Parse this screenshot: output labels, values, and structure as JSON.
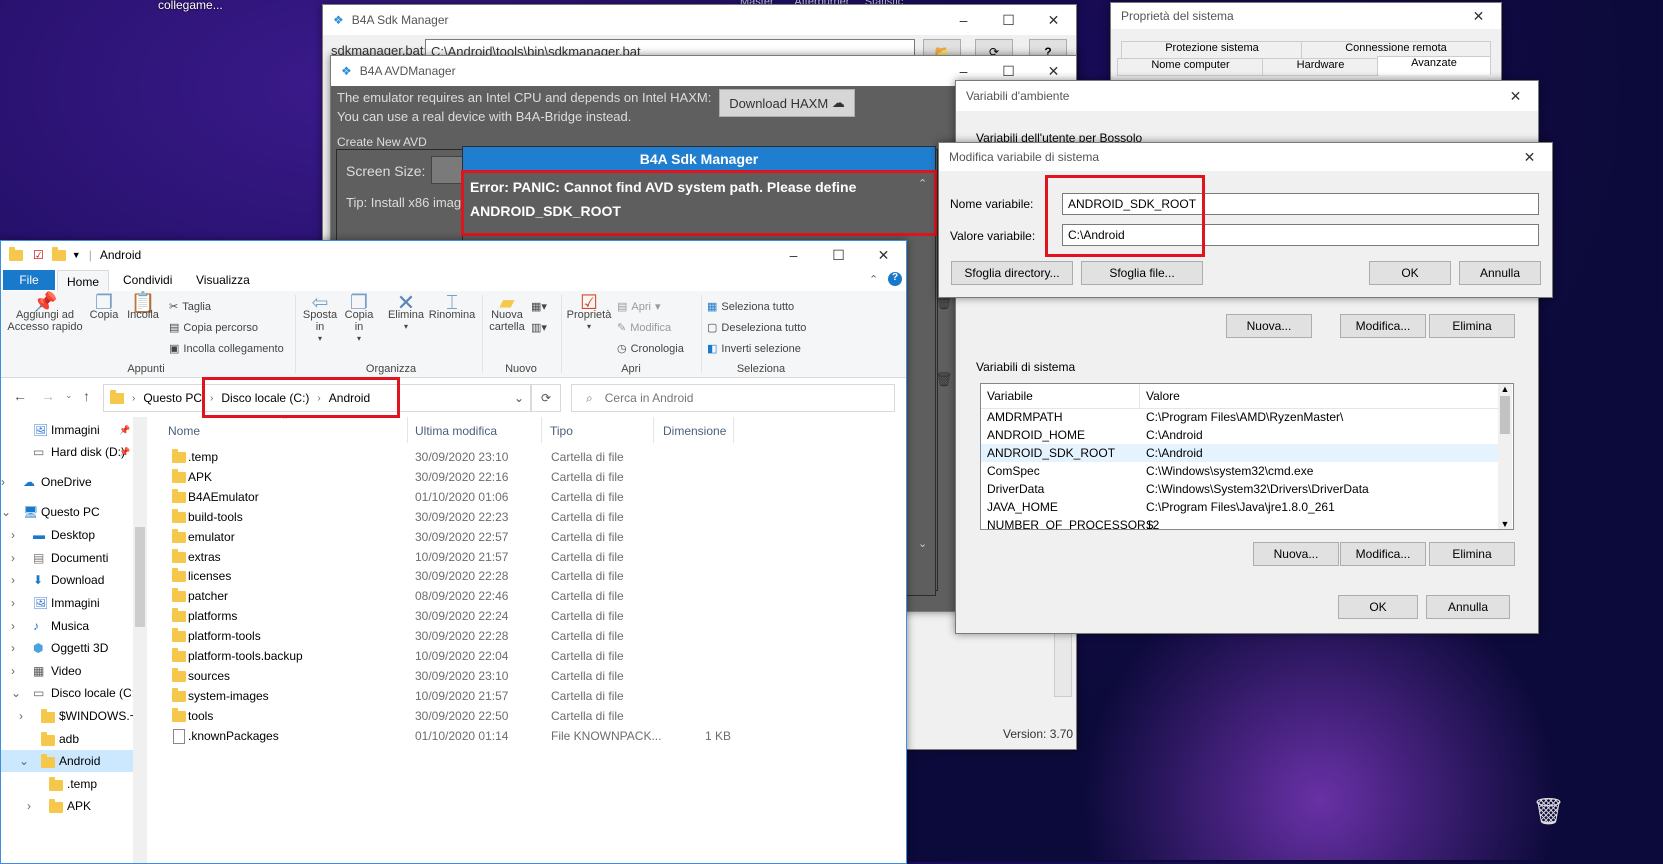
{
  "desktop": {
    "top_label": "collegame..."
  },
  "sdk_manager": {
    "title": "B4A Sdk Manager",
    "sdkmanager_label": "sdkmanager.bat:",
    "sdkmanager_path": "C:\\Android\\tools\\bin\\sdkmanager.bat",
    "version": "Version: 3.70"
  },
  "avd_manager": {
    "title": "B4A AVDManager",
    "haxm_line1": "The emulator requires an Intel CPU and depends on Intel HAXM:",
    "haxm_line2": "You can use a real device with B4A-Bridge instead.",
    "download_haxm": "Download HAXM",
    "create_avd": "Create New AVD",
    "screen_size": "Screen Size:",
    "tip": "Tip: Install x86 imag"
  },
  "error_dialog": {
    "title": "B4A Sdk Manager",
    "message_line1": "Error: PANIC: Cannot find AVD system path. Please define",
    "message_line2": "ANDROID_SDK_ROOT"
  },
  "system_properties": {
    "title": "Proprietà del sistema",
    "tabs_row1": [
      "Protezione sistema",
      "Connessione remota"
    ],
    "tabs_row2": [
      "Nome computer",
      "Hardware",
      "Avanzate"
    ]
  },
  "env_vars": {
    "title": "Variabili d'ambiente",
    "user_section": "Variabili dell'utente per Bossolo",
    "user_buttons": [
      "Nuova...",
      "Modifica...",
      "Elimina"
    ],
    "system_section": "Variabili di sistema",
    "columns": [
      "Variabile",
      "Valore"
    ],
    "rows": [
      [
        "AMDRMPATH",
        "C:\\Program Files\\AMD\\RyzenMaster\\"
      ],
      [
        "ANDROID_HOME",
        "C:\\Android"
      ],
      [
        "ANDROID_SDK_ROOT",
        "C:\\Android"
      ],
      [
        "ComSpec",
        "C:\\Windows\\system32\\cmd.exe"
      ],
      [
        "DriverData",
        "C:\\Windows\\System32\\Drivers\\DriverData"
      ],
      [
        "JAVA_HOME",
        "C:\\Program Files\\Java\\jre1.8.0_261"
      ],
      [
        "NUMBER_OF_PROCESSORS",
        "12"
      ]
    ],
    "system_buttons": [
      "Nuova...",
      "Modifica...",
      "Elimina"
    ],
    "ok": "OK",
    "cancel": "Annulla"
  },
  "edit_var": {
    "title": "Modifica variabile di sistema",
    "name_label": "Nome variabile:",
    "name_value": "ANDROID_SDK_ROOT",
    "value_label": "Valore variabile:",
    "value_value": "C:\\Android",
    "browse_dir": "Sfoglia directory...",
    "browse_file": "Sfoglia file...",
    "ok": "OK",
    "cancel": "Annulla"
  },
  "explorer": {
    "title": "Android",
    "ribbon_tabs": [
      "File",
      "Home",
      "Condividi",
      "Visualizza"
    ],
    "appunti": {
      "label": "Appunti",
      "pin": "Aggiungi ad Accesso rapido",
      "copy": "Copia",
      "paste": "Incolla",
      "cut": "Taglia",
      "copy_path": "Copia percorso",
      "paste_link": "Incolla collegamento"
    },
    "organizza": {
      "label": "Organizza",
      "move": "Sposta in",
      "copy_to": "Copia in",
      "delete": "Elimina",
      "rename": "Rinomina"
    },
    "nuovo": {
      "label": "Nuovo",
      "new_folder": "Nuova cartella"
    },
    "apri": {
      "label": "Apri",
      "properties": "Proprietà",
      "open": "Apri",
      "edit": "Modifica",
      "history": "Cronologia"
    },
    "seleziona": {
      "label": "Seleziona",
      "select_all": "Seleziona tutto",
      "deselect_all": "Deseleziona tutto",
      "invert": "Inverti selezione"
    },
    "breadcrumb": [
      "Questo PC",
      "Disco locale (C:)",
      "Android"
    ],
    "search_placeholder": "Cerca in Android",
    "columns": [
      "Nome",
      "Ultima modifica",
      "Tipo",
      "Dimensione"
    ],
    "files": [
      {
        "name": ".temp",
        "date": "30/09/2020 23:10",
        "type": "Cartella di file",
        "size": "",
        "kind": "folder"
      },
      {
        "name": "APK",
        "date": "30/09/2020 22:16",
        "type": "Cartella di file",
        "size": "",
        "kind": "folder"
      },
      {
        "name": "B4AEmulator",
        "date": "01/10/2020 01:06",
        "type": "Cartella di file",
        "size": "",
        "kind": "folder"
      },
      {
        "name": "build-tools",
        "date": "30/09/2020 22:23",
        "type": "Cartella di file",
        "size": "",
        "kind": "folder"
      },
      {
        "name": "emulator",
        "date": "30/09/2020 22:57",
        "type": "Cartella di file",
        "size": "",
        "kind": "folder"
      },
      {
        "name": "extras",
        "date": "10/09/2020 21:57",
        "type": "Cartella di file",
        "size": "",
        "kind": "folder"
      },
      {
        "name": "licenses",
        "date": "30/09/2020 22:28",
        "type": "Cartella di file",
        "size": "",
        "kind": "folder"
      },
      {
        "name": "patcher",
        "date": "08/09/2020 22:46",
        "type": "Cartella di file",
        "size": "",
        "kind": "folder"
      },
      {
        "name": "platforms",
        "date": "30/09/2020 22:24",
        "type": "Cartella di file",
        "size": "",
        "kind": "folder"
      },
      {
        "name": "platform-tools",
        "date": "30/09/2020 22:28",
        "type": "Cartella di file",
        "size": "",
        "kind": "folder"
      },
      {
        "name": "platform-tools.backup",
        "date": "10/09/2020 22:04",
        "type": "Cartella di file",
        "size": "",
        "kind": "folder"
      },
      {
        "name": "sources",
        "date": "30/09/2020 23:10",
        "type": "Cartella di file",
        "size": "",
        "kind": "folder"
      },
      {
        "name": "system-images",
        "date": "10/09/2020 21:57",
        "type": "Cartella di file",
        "size": "",
        "kind": "folder"
      },
      {
        "name": "tools",
        "date": "30/09/2020 22:50",
        "type": "Cartella di file",
        "size": "",
        "kind": "folder"
      },
      {
        "name": ".knownPackages",
        "date": "01/10/2020 01:14",
        "type": "File KNOWNPACK...",
        "size": "1 KB",
        "kind": "file"
      }
    ],
    "nav_tree": [
      {
        "label": "Immagini",
        "kind": "pics"
      },
      {
        "label": "Hard disk (D:)",
        "kind": "drive"
      },
      {
        "label": "OneDrive",
        "kind": "cloud"
      },
      {
        "label": "Questo PC",
        "kind": "pc"
      },
      {
        "label": "Desktop",
        "kind": "desktop"
      },
      {
        "label": "Documenti",
        "kind": "docs"
      },
      {
        "label": "Download",
        "kind": "download"
      },
      {
        "label": "Immagini",
        "kind": "pics"
      },
      {
        "label": "Musica",
        "kind": "music"
      },
      {
        "label": "Oggetti 3D",
        "kind": "obj3d"
      },
      {
        "label": "Video",
        "kind": "video"
      },
      {
        "label": "Disco locale (C:)",
        "kind": "drive"
      },
      {
        "label": "$WINDOWS.~B",
        "kind": "folder"
      },
      {
        "label": "adb",
        "kind": "folder"
      },
      {
        "label": "Android",
        "kind": "folder"
      },
      {
        "label": ".temp",
        "kind": "folder"
      },
      {
        "label": "APK",
        "kind": "folder"
      }
    ]
  }
}
